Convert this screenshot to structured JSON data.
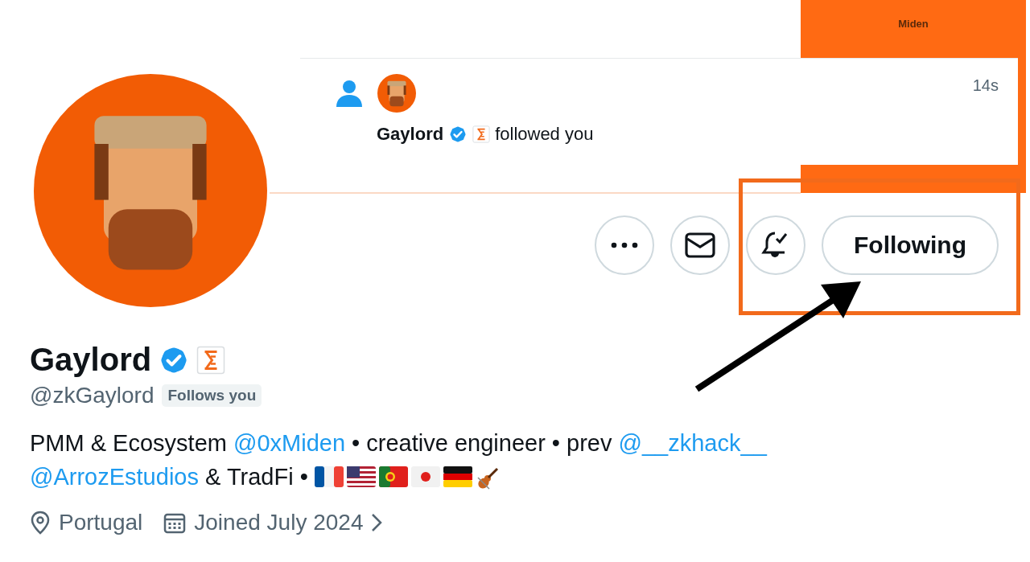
{
  "banner": {
    "brand": "Miden"
  },
  "notification": {
    "time": "14s",
    "user": "Gaylord",
    "verified": true,
    "affiliate": true,
    "action": "followed you"
  },
  "profile": {
    "name": "Gaylord",
    "verified": true,
    "affiliate": true,
    "handle": "@zkGaylord",
    "follows_you": "Follows you",
    "actions": [
      {
        "kind": "more"
      },
      {
        "kind": "message"
      },
      {
        "kind": "notify"
      },
      {
        "kind": "follow",
        "label": "Following"
      }
    ],
    "bio": [
      [
        {
          "kind": "text",
          "text": "PMM & Ecosystem "
        },
        {
          "kind": "mention",
          "text": "@0xMiden"
        },
        {
          "kind": "text",
          "text": " • creative engineer • prev "
        },
        {
          "kind": "mention",
          "text": "@__zkhack__"
        }
      ],
      [
        {
          "kind": "mention",
          "text": "@ArrozEstudios"
        },
        {
          "kind": "text",
          "text": " & TradFi • "
        },
        {
          "kind": "flags"
        }
      ]
    ],
    "location": "Portugal",
    "joined": "Joined July 2024"
  }
}
